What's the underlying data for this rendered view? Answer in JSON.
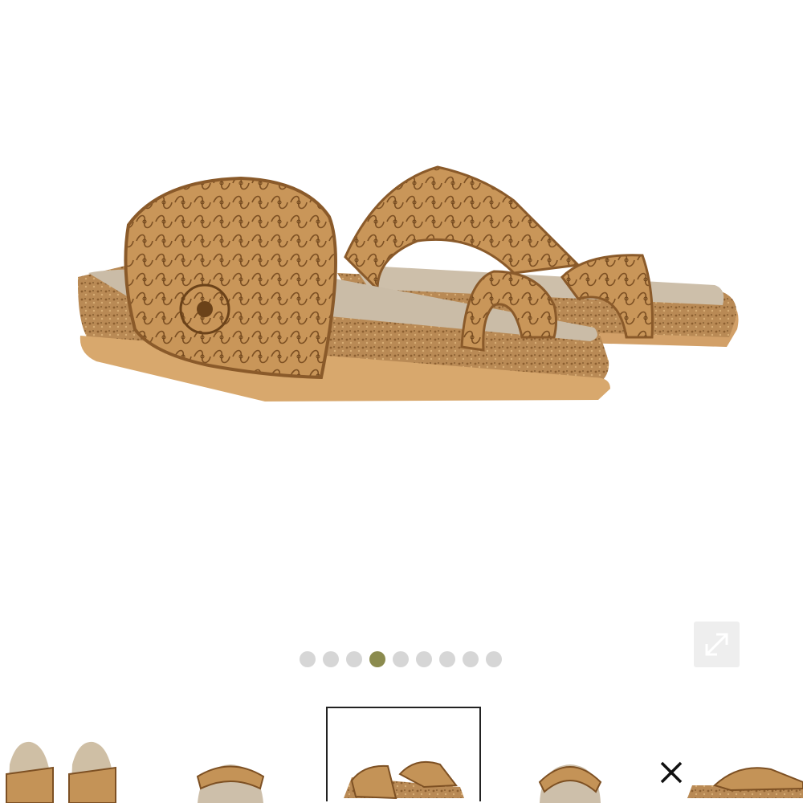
{
  "gallery": {
    "current_index": 4,
    "dot_count": 9,
    "colors": {
      "active_dot": "#8b8b4e",
      "inactive_dot": "#d6d6d6",
      "leather": "#c99659",
      "cork": "#b98a55",
      "footbed": "#c9bca8"
    }
  },
  "icons": {
    "expand": "expand-arrows-icon",
    "close": "close-icon"
  }
}
